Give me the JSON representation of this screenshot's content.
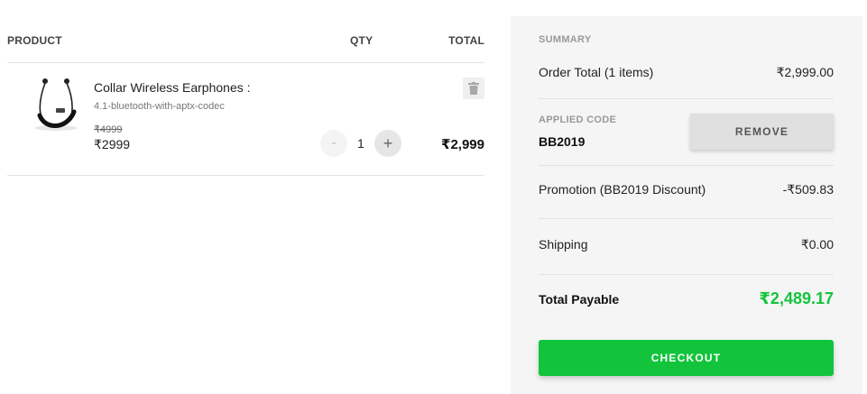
{
  "cart": {
    "headers": {
      "product": "PRODUCT",
      "qty": "QTY",
      "total": "TOTAL"
    },
    "item": {
      "name": "Collar Wireless Earphones :",
      "variant": "4.1-bluetooth-with-aptx-codec",
      "old_price": "₹4999",
      "price": "₹2999",
      "qty_minus": "-",
      "qty": "1",
      "qty_plus": "+",
      "total": "₹2,999",
      "thumbnail_icon": "earphones-icon",
      "delete_icon": "trash-icon"
    }
  },
  "summary": {
    "title": "SUMMARY",
    "order_total_label": "Order Total (1 items)",
    "order_total_value": "₹2,999.00",
    "applied_code_caption": "APPLIED CODE",
    "applied_code": "BB2019",
    "remove_label": "REMOVE",
    "promotion_label": "Promotion (BB2019 Discount)",
    "promotion_value": "-₹509.83",
    "shipping_label": "Shipping",
    "shipping_value": "₹0.00",
    "total_payable_label": "Total Payable",
    "total_payable_value": "₹2,489.17",
    "checkout_label": "CHECKOUT"
  },
  "colors": {
    "accent_green": "#12c43c",
    "panel_bg": "#f5f5f5"
  }
}
